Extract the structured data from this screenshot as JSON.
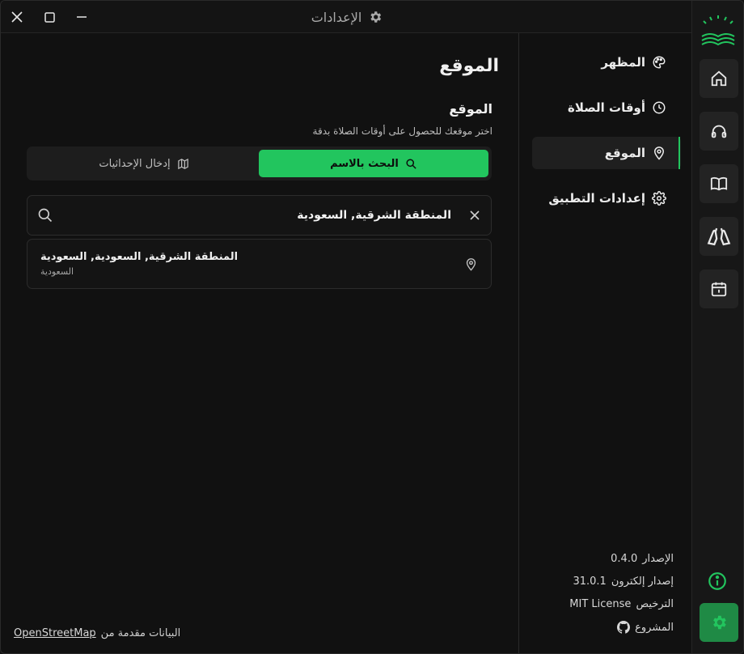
{
  "window": {
    "title": "الإعدادات",
    "close_icon": "close-icon",
    "maximize_icon": "maximize-icon",
    "minimize_icon": "minimize-icon"
  },
  "colors": {
    "accent": "#22c55e",
    "background": "#111111",
    "panel": "#1d1d1d"
  },
  "nav": {
    "items": [
      {
        "label": "المظهر",
        "icon": "palette-icon"
      },
      {
        "label": "أوقات الصلاة",
        "icon": "clock-icon"
      },
      {
        "label": "الموقع",
        "icon": "map-pin-icon",
        "active": true
      },
      {
        "label": "إعدادات التطبيق",
        "icon": "gear-icon"
      }
    ]
  },
  "about": {
    "version_label": "الإصدار",
    "version": "0.4.0",
    "electron_label": "إصدار إلكترون",
    "electron": "31.0.1",
    "license_label": "الترخيص",
    "license": "MIT License",
    "project_label": "المشروع"
  },
  "main": {
    "page_title": "الموقع",
    "section_title": "الموقع",
    "section_desc": "اختر موقعك للحصول على أوقات الصلاة بدقة",
    "search_by_name": "البحث بالاسم",
    "enter_coords": "إدخال الإحداثيات",
    "search_value": "المنطقة الشرقية, السعودية",
    "result_name": "المنطقة الشرقية, السعودية, السعودية",
    "result_sub": "السعودية",
    "attribution_text": "البيانات مقدمة من",
    "attribution_link": "OpenStreetMap"
  },
  "rail": {
    "items": [
      "home-icon",
      "headphones-icon",
      "book-icon",
      "praying-hands-icon",
      "calendar-icon",
      "info-icon",
      "gear-icon"
    ]
  }
}
